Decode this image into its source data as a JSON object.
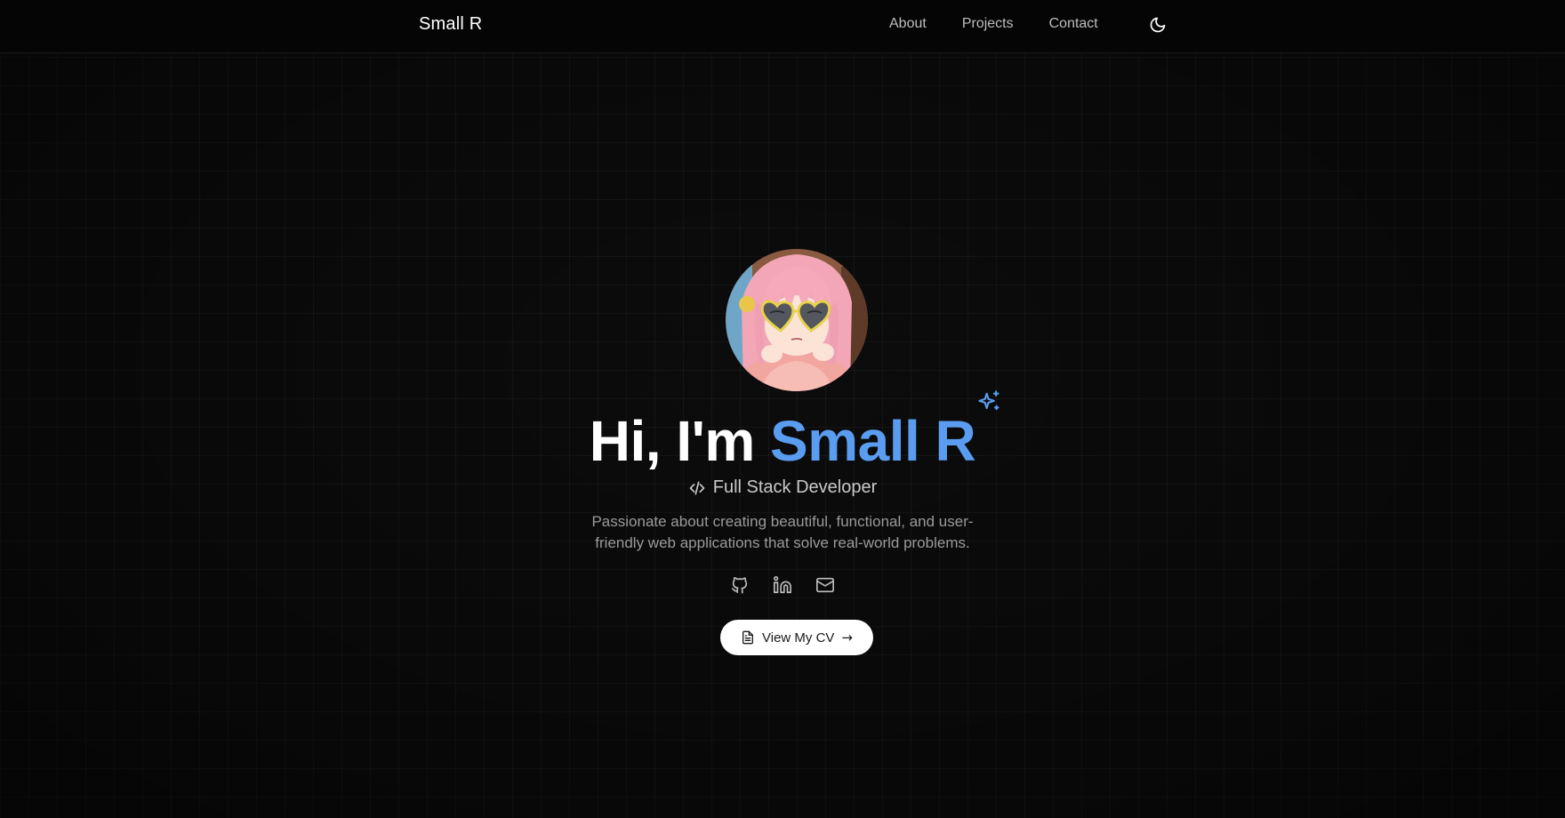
{
  "header": {
    "brand": "Small R",
    "nav": [
      {
        "label": "About"
      },
      {
        "label": "Projects"
      },
      {
        "label": "Contact"
      }
    ],
    "theme_toggle_icon": "moon-icon"
  },
  "hero": {
    "avatar_alt": "Avatar",
    "greeting_prefix": "Hi, I'm ",
    "name": "Small R",
    "role_icon": "code-icon",
    "role": "Full Stack Developer",
    "description": "Passionate about creating beautiful, functional, and user-friendly web applications that solve real-world problems.",
    "socials": [
      {
        "icon": "github-icon"
      },
      {
        "icon": "linkedin-icon"
      },
      {
        "icon": "mail-icon"
      }
    ],
    "cv_button": {
      "icon": "document-icon",
      "label": "View My CV",
      "arrow": "→"
    }
  },
  "colors": {
    "background": "#0c0c0c",
    "accent": "#5a9df0",
    "text": "#ffffff",
    "muted": "#9a9a9a"
  }
}
